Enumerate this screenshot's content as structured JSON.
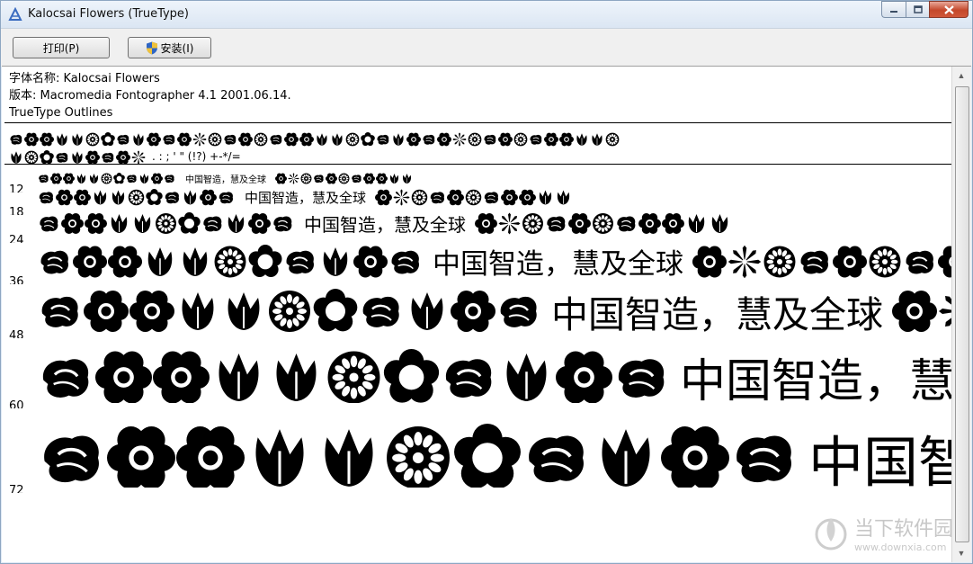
{
  "window": {
    "title": "Kalocsai Flowers (TrueType)"
  },
  "toolbar": {
    "print_label": "打印(P)",
    "install_label": "安装(I)"
  },
  "info": {
    "font_name_line": "字体名称: Kalocsai Flowers",
    "version_line": "版本: Macromedia Fontographer 4.1 2001.06.14.",
    "outline_line": "TrueType Outlines"
  },
  "charset": {
    "punct_line": ". : ;  '  \"   (!?)   +-*/="
  },
  "samples": {
    "cjk_text": "中国智造，慧及全球",
    "rows": [
      {
        "size": "12"
      },
      {
        "size": "18"
      },
      {
        "size": "24"
      },
      {
        "size": "36"
      },
      {
        "size": "48"
      },
      {
        "size": "60"
      },
      {
        "size": "72"
      }
    ]
  },
  "watermark": {
    "brand": "当下软件园",
    "url": "www.downxia.com"
  },
  "colors": {
    "window_border": "#8ea7c2",
    "toolbar_bg": "#f0f0f0",
    "close_red": "#c4472b"
  }
}
